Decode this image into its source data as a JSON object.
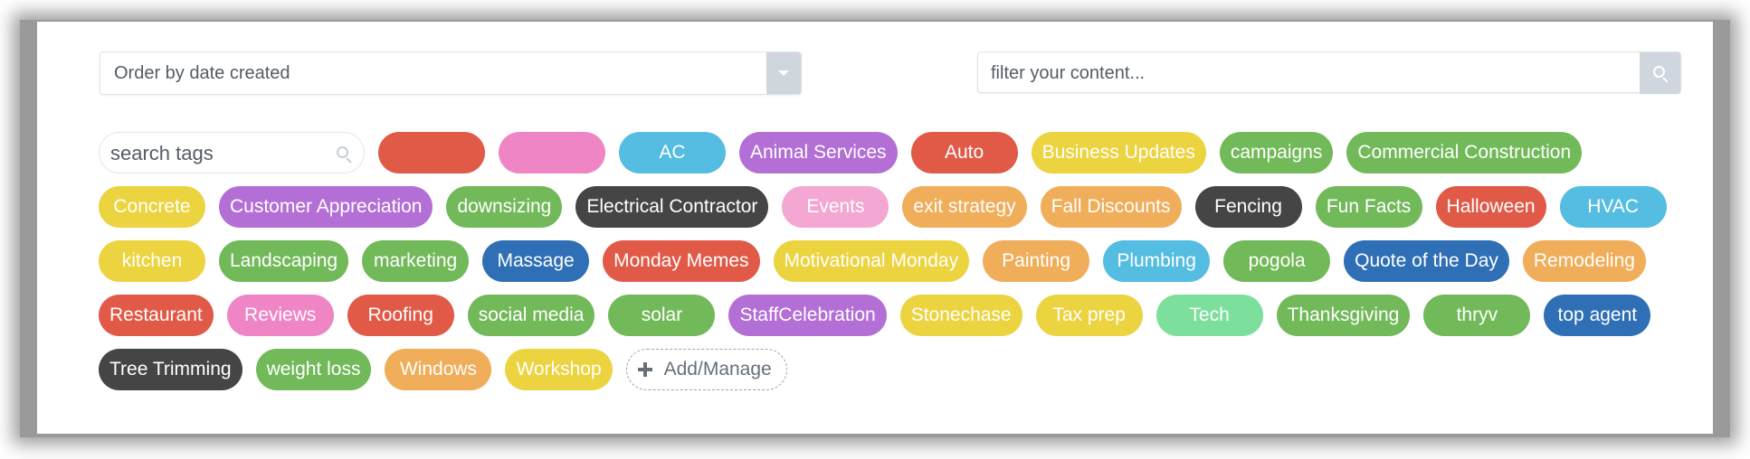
{
  "order": {
    "selected": "Order by date created"
  },
  "filter": {
    "placeholder": "filter your content..."
  },
  "tag_search": {
    "placeholder": "search tags"
  },
  "tags": [
    {
      "label": "",
      "color": "#e05a47"
    },
    {
      "label": "",
      "color": "#ef85c4"
    },
    {
      "label": "AC",
      "color": "#55bde1"
    },
    {
      "label": "Animal Services",
      "color": "#b36fd6"
    },
    {
      "label": "Auto",
      "color": "#e05a47"
    },
    {
      "label": "Business Updates",
      "color": "#ecd340"
    },
    {
      "label": "campaigns",
      "color": "#72b95a"
    },
    {
      "label": "Commercial Construction",
      "color": "#72b95a"
    },
    {
      "label": "Concrete",
      "color": "#ecd340"
    },
    {
      "label": "Customer Appreciation",
      "color": "#b36fd6"
    },
    {
      "label": "downsizing",
      "color": "#72b95a"
    },
    {
      "label": "Electrical Contractor",
      "color": "#454545"
    },
    {
      "label": "Events",
      "color": "#f3a7d2"
    },
    {
      "label": "exit strategy",
      "color": "#f0ad5a"
    },
    {
      "label": "Fall Discounts",
      "color": "#f0ad5a"
    },
    {
      "label": "Fencing",
      "color": "#454545"
    },
    {
      "label": "Fun Facts",
      "color": "#72b95a"
    },
    {
      "label": "Halloween",
      "color": "#e05a47"
    },
    {
      "label": "HVAC",
      "color": "#55bde1"
    },
    {
      "label": "kitchen",
      "color": "#ecd340"
    },
    {
      "label": "Landscaping",
      "color": "#72b95a"
    },
    {
      "label": "marketing",
      "color": "#72b95a"
    },
    {
      "label": "Massage",
      "color": "#2f6fb5"
    },
    {
      "label": "Monday Memes",
      "color": "#e05a47"
    },
    {
      "label": "Motivational Monday",
      "color": "#ecd340"
    },
    {
      "label": "Painting",
      "color": "#f0ad5a"
    },
    {
      "label": "Plumbing",
      "color": "#55bde1"
    },
    {
      "label": "pogola",
      "color": "#72b95a"
    },
    {
      "label": "Quote of the Day",
      "color": "#2f6fb5"
    },
    {
      "label": "Remodeling",
      "color": "#f0ad5a"
    },
    {
      "label": "Restaurant",
      "color": "#e05a47"
    },
    {
      "label": "Reviews",
      "color": "#ef85c4"
    },
    {
      "label": "Roofing",
      "color": "#e05a47"
    },
    {
      "label": "social media",
      "color": "#72b95a"
    },
    {
      "label": "solar",
      "color": "#72b95a"
    },
    {
      "label": "StaffCelebration",
      "color": "#b36fd6"
    },
    {
      "label": "Stonechase",
      "color": "#ecd340"
    },
    {
      "label": "Tax prep",
      "color": "#ecd340"
    },
    {
      "label": "Tech",
      "color": "#7ddf9c"
    },
    {
      "label": "Thanksgiving",
      "color": "#72b95a"
    },
    {
      "label": "thryv",
      "color": "#72b95a"
    },
    {
      "label": "top agent",
      "color": "#2f6fb5"
    },
    {
      "label": "Tree Trimming",
      "color": "#454545"
    },
    {
      "label": "weight loss",
      "color": "#72b95a"
    },
    {
      "label": "Windows",
      "color": "#f0ad5a"
    },
    {
      "label": "Workshop",
      "color": "#ecd340"
    }
  ],
  "add_manage": {
    "label": "Add/Manage",
    "icon": "plus-icon"
  }
}
